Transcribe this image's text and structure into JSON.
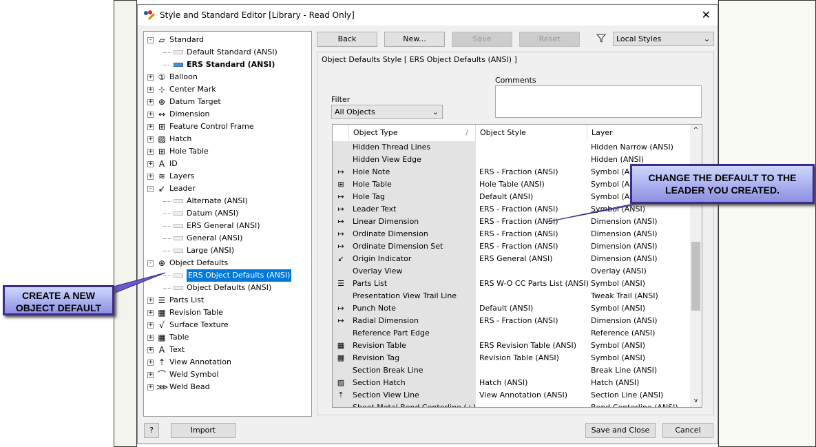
{
  "window": {
    "title": "Style and Standard Editor [Library - Read Only]",
    "close": "✕"
  },
  "tree": [
    {
      "label": "Standard",
      "level": 0,
      "exp": "-",
      "icon": "▱",
      "name": "standard"
    },
    {
      "label": "Default Standard (ANSI)",
      "level": 1,
      "name": "default-standard"
    },
    {
      "label": "ERS Standard (ANSI)",
      "level": 1,
      "bold": true,
      "active": true,
      "name": "ers-standard"
    },
    {
      "label": "Balloon",
      "level": 0,
      "exp": "+",
      "icon": "①",
      "name": "balloon"
    },
    {
      "label": "Center Mark",
      "level": 0,
      "exp": "+",
      "icon": "⊹",
      "name": "center-mark"
    },
    {
      "label": "Datum Target",
      "level": 0,
      "exp": "+",
      "icon": "⊕",
      "name": "datum-target"
    },
    {
      "label": "Dimension",
      "level": 0,
      "exp": "+",
      "icon": "↔",
      "name": "dimension"
    },
    {
      "label": "Feature Control Frame",
      "level": 0,
      "exp": "+",
      "icon": "⊞",
      "name": "feature-control-frame"
    },
    {
      "label": "Hatch",
      "level": 0,
      "exp": "+",
      "icon": "▨",
      "name": "hatch"
    },
    {
      "label": "Hole Table",
      "level": 0,
      "exp": "+",
      "icon": "⊞",
      "name": "hole-table"
    },
    {
      "label": "ID",
      "level": 0,
      "exp": "+",
      "icon": "A",
      "name": "id"
    },
    {
      "label": "Layers",
      "level": 0,
      "exp": "+",
      "icon": "≋",
      "name": "layers"
    },
    {
      "label": "Leader",
      "level": 0,
      "exp": "-",
      "icon": "↙",
      "name": "leader"
    },
    {
      "label": "Alternate (ANSI)",
      "level": 1,
      "name": "alternate"
    },
    {
      "label": "Datum (ANSI)",
      "level": 1,
      "name": "datum"
    },
    {
      "label": "ERS General (ANSI)",
      "level": 1,
      "name": "ers-general"
    },
    {
      "label": "General (ANSI)",
      "level": 1,
      "name": "general"
    },
    {
      "label": "Large (ANSI)",
      "level": 1,
      "name": "large"
    },
    {
      "label": "Object Defaults",
      "level": 0,
      "exp": "-",
      "icon": "⊕",
      "name": "object-defaults"
    },
    {
      "label": "ERS Object Defaults (ANSI)",
      "level": 1,
      "selected": true,
      "name": "ers-object-defaults"
    },
    {
      "label": "Object Defaults (ANSI)",
      "level": 1,
      "name": "object-defaults-ansi"
    },
    {
      "label": "Parts List",
      "level": 0,
      "exp": "+",
      "icon": "☰",
      "name": "parts-list"
    },
    {
      "label": "Revision Table",
      "level": 0,
      "exp": "+",
      "icon": "▦",
      "name": "revision-table"
    },
    {
      "label": "Surface Texture",
      "level": 0,
      "exp": "+",
      "icon": "√",
      "name": "surface-texture"
    },
    {
      "label": "Table",
      "level": 0,
      "exp": "+",
      "icon": "▦",
      "name": "table"
    },
    {
      "label": "Text",
      "level": 0,
      "exp": "+",
      "icon": "A",
      "name": "text"
    },
    {
      "label": "View Annotation",
      "level": 0,
      "exp": "+",
      "icon": "⇡",
      "name": "view-annotation"
    },
    {
      "label": "Weld Symbol",
      "level": 0,
      "exp": "+",
      "icon": "⌒",
      "name": "weld-symbol"
    },
    {
      "label": "Weld Bead",
      "level": 0,
      "exp": "+",
      "icon": "⋙",
      "name": "weld-bead"
    }
  ],
  "toolbar": {
    "back": "Back",
    "new": "New...",
    "save": "Save",
    "reset": "Reset",
    "filter_icon": "funnel-icon",
    "styles_select": "Local Styles"
  },
  "panel": {
    "title": "Object Defaults Style [ ERS Object Defaults (ANSI) ]",
    "filter_label": "Filter",
    "filter_value": "All Objects",
    "comments_label": "Comments"
  },
  "table": {
    "headers": [
      "Object Type",
      "Object Style",
      "Layer"
    ],
    "rows": [
      [
        "",
        "Hidden Thread Lines",
        "",
        "Hidden Narrow (ANSI)"
      ],
      [
        "",
        "Hidden View Edge",
        "",
        "Hidden (ANSI)"
      ],
      [
        "↦",
        "Hole Note",
        "ERS - Fraction (ANSI)",
        "Symbol (ANSI)"
      ],
      [
        "⊞",
        "Hole Table",
        "Hole Table (ANSI)",
        "Symbol (ANSI)"
      ],
      [
        "↦",
        "Hole Tag",
        "Default (ANSI)",
        "Symbol (ANSI)"
      ],
      [
        "↦",
        "Leader Text",
        "ERS - Fraction (ANSI)",
        "Symbol (ANSI)"
      ],
      [
        "↦",
        "Linear Dimension",
        "ERS - Fraction (ANSI)",
        "Dimension (ANSI)"
      ],
      [
        "↦",
        "Ordinate Dimension",
        "ERS - Fraction (ANSI)",
        "Dimension (ANSI)"
      ],
      [
        "↦",
        "Ordinate Dimension Set",
        "ERS - Fraction (ANSI)",
        "Dimension (ANSI)"
      ],
      [
        "↙",
        "Origin Indicator",
        "ERS General (ANSI)",
        "Dimension (ANSI)"
      ],
      [
        "",
        "Overlay View",
        "",
        "Overlay (ANSI)"
      ],
      [
        "☰",
        "Parts List",
        "ERS W-O CC Parts List (ANSI)",
        "Symbol (ANSI)"
      ],
      [
        "",
        "Presentation View Trail Line",
        "",
        "Tweak Trail (ANSI)"
      ],
      [
        "↦",
        "Punch Note",
        "Default (ANSI)",
        "Symbol (ANSI)"
      ],
      [
        "↦",
        "Radial Dimension",
        "ERS - Fraction (ANSI)",
        "Dimension (ANSI)"
      ],
      [
        "",
        "Reference Part Edge",
        "",
        "Reference (ANSI)"
      ],
      [
        "▦",
        "Revision Table",
        "ERS Revision Table (ANSI)",
        "Symbol (ANSI)"
      ],
      [
        "▦",
        "Revision Tag",
        "Revision Table (ANSI)",
        "Symbol (ANSI)"
      ],
      [
        "",
        "Section Break Line",
        "",
        "Break Line (ANSI)"
      ],
      [
        "▨",
        "Section Hatch",
        "Hatch (ANSI)",
        "Hatch (ANSI)"
      ],
      [
        "⇡",
        "Section View Line",
        "View Annotation (ANSI)",
        "Section Line (ANSI)"
      ],
      [
        "",
        "Sheet Metal Bend Centerline (+)",
        "",
        "Bend Centerline (ANSI)"
      ]
    ]
  },
  "footer": {
    "help": "?",
    "import": "Import",
    "save_close": "Save and Close",
    "cancel": "Cancel"
  },
  "callouts": {
    "right": "CHANGE THE DEFAULT TO THE LEADER YOU CREATED.",
    "left": "CREATE A NEW OBJECT DEFAULT"
  },
  "colors": {
    "selection": "#0078d7",
    "callout_border": "#3d2a8a"
  }
}
